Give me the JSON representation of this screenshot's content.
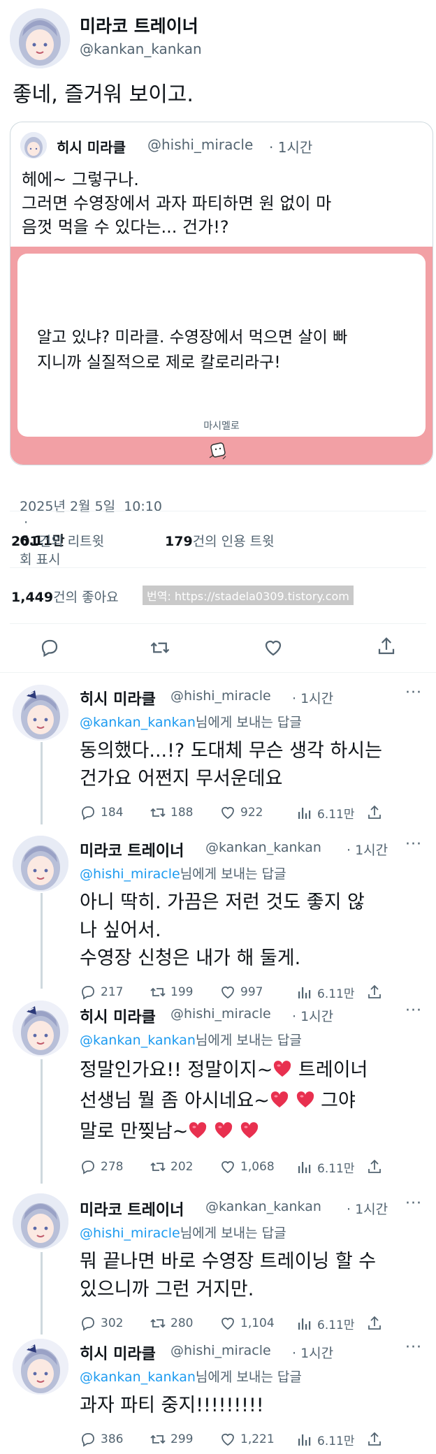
{
  "main_tweet": {
    "name": "미라코 트레이너",
    "handle": "@kankan_kankan",
    "text": "좋네, 즐거워 보이고.",
    "timestamp": "2025년 2월 5일  10:10",
    "views_count": "6.11만",
    "views_label": "회 표시",
    "retweets_count": "201",
    "retweets_label": "건의 리트윗",
    "quotes_count": "179",
    "quotes_label": "건의 인용 트윗",
    "likes_count": "1,449",
    "likes_label": "건의 좋아요",
    "watermark": "번역: https://stadela0309.tistory.com"
  },
  "quoted_tweet": {
    "name": "히시 미라클",
    "handle": "@hishi_miracle",
    "time": "· 1시간",
    "text_line1": "헤에~ 그렇구나.",
    "text_line2": "그러면 수영장에서 과자 파티하면 원 없이 마",
    "text_line3": "음껏 먹을 수 있다는... 건가!?",
    "card_line1": "알고 있냐? 미라클. 수영장에서 먹으면 살이 빠",
    "card_line2": "지니까 실질적으로 제로 칼로리라구!",
    "card_caption": "마시멜로"
  },
  "replies": [
    {
      "name": "히시 미라클",
      "handle": "@hishi_miracle",
      "time": "· 1시간",
      "reply_to": "@kankan_kankan",
      "reply_suffix": "님에게 보내는 답글",
      "lines": [
        "동의했다...!? 도대체 무슨 생각 하시는",
        "건가요 어쩐지 무서운데요"
      ],
      "replies": "184",
      "retweets": "188",
      "likes": "922",
      "views": "6.11만"
    },
    {
      "name": "미라코 트레이너",
      "handle": "@kankan_kankan",
      "time": "· 1시간",
      "reply_to": "@hishi_miracle",
      "reply_suffix": "님에게 보내는 답글",
      "lines": [
        "아니 딱히. 가끔은 저런 것도 좋지 않",
        "나 싶어서.",
        "수영장 신청은 내가 해 둘게."
      ],
      "replies": "217",
      "retweets": "199",
      "likes": "997",
      "views": "6.11만"
    },
    {
      "name": "히시 미라클",
      "handle": "@hishi_miracle",
      "time": "· 1시간",
      "reply_to": "@kankan_kankan",
      "reply_suffix": "님에게 보내는 답글",
      "lines": [
        "정말인가요!! 정말이지~",
        "트레이너",
        "선생님 뭘 좀 아시네요~",
        "그야",
        "말로 만찢남~"
      ],
      "replies": "278",
      "retweets": "202",
      "likes": "1,068",
      "views": "6.11만"
    },
    {
      "name": "미라코 트레이너",
      "handle": "@kankan_kankan",
      "time": "· 1시간",
      "reply_to": "@hishi_miracle",
      "reply_suffix": "님에게 보내는 답글",
      "lines": [
        "뭐 끝나면 바로 수영장 트레이닝 할 수",
        "있으니까 그런 거지만."
      ],
      "replies": "302",
      "retweets": "280",
      "likes": "1,104",
      "views": "6.11만"
    },
    {
      "name": "히시 미라클",
      "handle": "@hishi_miracle",
      "time": "· 1시간",
      "reply_to": "@kankan_kankan",
      "reply_suffix": "님에게 보내는 답글",
      "lines": [
        "과자 파티 중지!!!!!!!!!"
      ],
      "replies": "386",
      "retweets": "299",
      "likes": "1,221",
      "views": "6.11만"
    }
  ],
  "icons": {
    "reply": "reply-icon",
    "retweet": "retweet-icon",
    "like": "heart-icon",
    "views": "views-icon",
    "share": "share-icon",
    "more": "more-icon",
    "emoji": "heart-emoji"
  },
  "colors": {
    "accent": "#1d9bf0",
    "card_border": "#f2a0a5",
    "emoji_heart": "#e8304f"
  }
}
